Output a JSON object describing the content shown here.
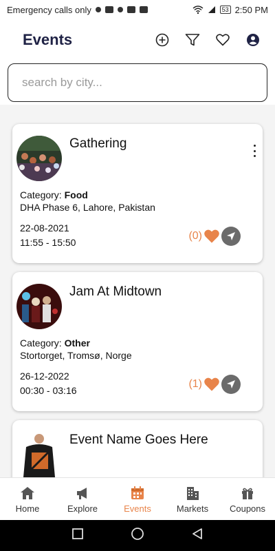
{
  "status_bar": {
    "left_text": "Emergency calls only",
    "battery": "53",
    "time": "2:50 PM"
  },
  "header": {
    "title": "Events"
  },
  "search": {
    "placeholder": "search by city..."
  },
  "events": [
    {
      "title": "Gathering",
      "category_label": "Category:",
      "category": "Food",
      "location": "DHA Phase 6, Lahore, Pakistan",
      "date": "22-08-2021",
      "time": "11:55 - 15:50",
      "likes": "(0)"
    },
    {
      "title": "Jam At Midtown",
      "category_label": "Category:",
      "category": "Other",
      "location": "Stortorget, Tromsø, Norge",
      "date": "26-12-2022",
      "time": "00:30 - 03:16",
      "likes": "(1)"
    },
    {
      "title": "Event Name Goes Here"
    }
  ],
  "bottom_nav": [
    {
      "label": "Home",
      "icon": "home-icon"
    },
    {
      "label": "Explore",
      "icon": "megaphone-icon"
    },
    {
      "label": "Events",
      "icon": "calendar-icon"
    },
    {
      "label": "Markets",
      "icon": "building-icon"
    },
    {
      "label": "Coupons",
      "icon": "gift-icon"
    }
  ],
  "colors": {
    "accent": "#e8844a",
    "title": "#1f2245",
    "nav_button": "#6b6b6b"
  }
}
